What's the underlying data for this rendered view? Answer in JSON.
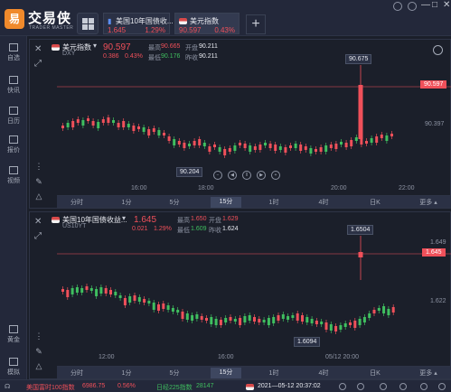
{
  "app": {
    "logo_glyph": "易",
    "brand": "交易侠",
    "brand_sub": "TRADER MASTER"
  },
  "tabs": [
    {
      "name": "美国10年国债收...",
      "price": "1.645",
      "pct": "1.29%",
      "icon": "chart-icon"
    },
    {
      "name": "美元指数",
      "price": "90.597",
      "pct": "0.43%",
      "icon": "us-flag-icon"
    }
  ],
  "add_tab_label": "+",
  "window": {
    "minimize": "—",
    "maximize": "□",
    "close": "✕"
  },
  "sidebar": [
    {
      "label": "自选",
      "icon": "star-icon"
    },
    {
      "label": "快讯",
      "icon": "news-icon"
    },
    {
      "label": "日历",
      "icon": "calendar-icon"
    },
    {
      "label": "报价",
      "icon": "quote-icon"
    },
    {
      "label": "视频",
      "icon": "video-icon"
    },
    {
      "label": "黄金",
      "icon": "gold-icon"
    },
    {
      "label": "模拟",
      "icon": "simulate-icon"
    }
  ],
  "panel1": {
    "name": "美元指数",
    "code": "DXY",
    "price": "90.597",
    "change": "0.386",
    "pct": "0.43%",
    "high_label": "最高",
    "high": "90.665",
    "open_label": "开盘",
    "open": "90.211",
    "low_label": "最低",
    "low": "90.176",
    "prev_label": "昨收",
    "prev": "90.211",
    "peak_label": "90.675",
    "current_tag": "90.597",
    "right_axis": "90.397",
    "low_marker": "90.204",
    "x_labels": [
      "16:00",
      "18:00",
      "20:00",
      "22:00"
    ],
    "timeframes": [
      "分时",
      "1分",
      "5分",
      "15分",
      "1时",
      "4时",
      "日K",
      "更多 ▴"
    ],
    "active_tf": "15分",
    "colors": {
      "up": "#f0505a",
      "down": "#3fbf5f",
      "bg": "#1b1f2a"
    }
  },
  "panel2": {
    "name": "美国10年国债收益...",
    "code": "US10YT",
    "price": "1.645",
    "change": "0.021",
    "pct": "1.29%",
    "high_label": "最高",
    "high": "1.650",
    "open_label": "开盘",
    "open": "1.629",
    "low_label": "最低",
    "low": "1.609",
    "prev_label": "昨收",
    "prev": "1.624",
    "peak_label": "1.6504",
    "current_tag": "1.645",
    "right_axis_top": "1.649",
    "right_axis_mid": "1.622",
    "low_marker": "1.6094",
    "x_labels": [
      "12:00",
      "16:00",
      "05/12 20:00"
    ],
    "timeframes": [
      "分时",
      "1分",
      "5分",
      "15分",
      "1时",
      "4时",
      "日K",
      "更多 ▴"
    ],
    "active_tf": "15分"
  },
  "status": {
    "item1_name": "美国富时100指数",
    "item1_value": "6986.75",
    "item1_pct": "0.56%",
    "item2_name": "日经225指数",
    "item2_value": "28147",
    "datetime": "2021—05-12 20:37:02"
  }
}
